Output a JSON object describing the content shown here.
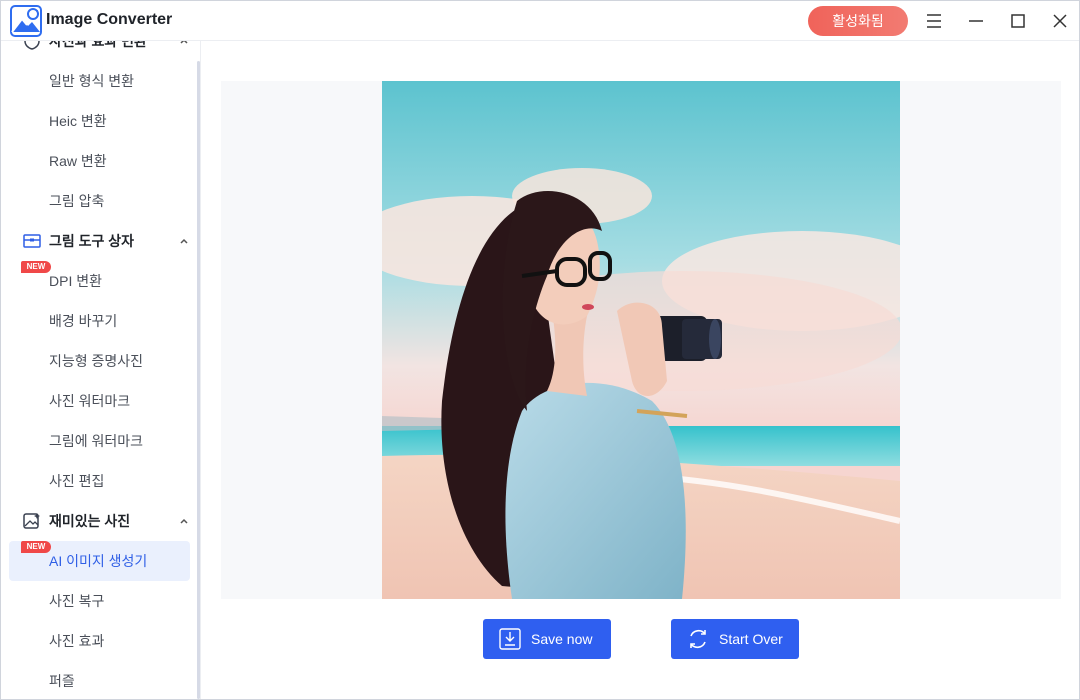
{
  "app": {
    "title": "Image Converter",
    "activate_label": "활성화됨",
    "accent_color": "#2f5ff0"
  },
  "window_controls": [
    "menu-icon",
    "minimize-icon",
    "maximize-icon",
    "close-icon"
  ],
  "sidebar": {
    "top_section": {
      "label": "사진과 효과 변환",
      "icon": "shield-icon"
    },
    "items_group1": [
      {
        "label": "일반 형식 변환"
      },
      {
        "label": "Heic 변환"
      },
      {
        "label": "Raw 변환"
      },
      {
        "label": "그림 압축"
      }
    ],
    "section2": {
      "label": "그림 도구 상자",
      "icon": "toolbox-icon"
    },
    "items_group2": [
      {
        "label": "DPI 변환",
        "badge": "NEW"
      },
      {
        "label": "배경 바꾸기"
      },
      {
        "label": "지능형 증명사진"
      },
      {
        "label": "사진 워터마크"
      },
      {
        "label": "그림에 워터마크"
      },
      {
        "label": "사진 편집"
      }
    ],
    "section3": {
      "label": "재미있는 사진",
      "icon": "photo-sparkle-icon"
    },
    "items_group3": [
      {
        "label": "AI 이미지 생성기",
        "badge": "NEW",
        "active": true
      },
      {
        "label": "사진 복구"
      },
      {
        "label": "사진 효과"
      },
      {
        "label": "퍼즐"
      }
    ]
  },
  "main": {
    "preview_image": "ai-generated-portrait-image",
    "save_label": "Save now",
    "start_over_label": "Start Over"
  }
}
